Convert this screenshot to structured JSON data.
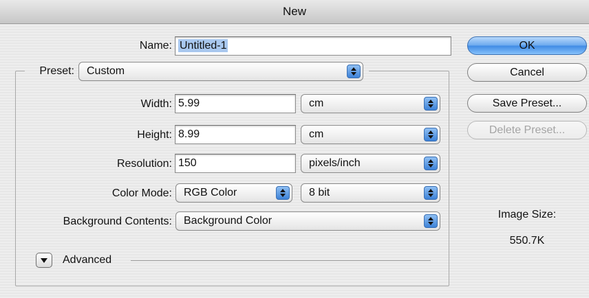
{
  "window": {
    "title": "New"
  },
  "name": {
    "label": "Name:",
    "value": "Untitled-1"
  },
  "preset": {
    "label": "Preset:",
    "value": "Custom"
  },
  "width": {
    "label": "Width:",
    "value": "5.99",
    "unit": "cm"
  },
  "height": {
    "label": "Height:",
    "value": "8.99",
    "unit": "cm"
  },
  "resolution": {
    "label": "Resolution:",
    "value": "150",
    "unit": "pixels/inch"
  },
  "color_mode": {
    "label": "Color Mode:",
    "value": "RGB Color",
    "depth": "8 bit"
  },
  "background": {
    "label": "Background Contents:",
    "value": "Background Color"
  },
  "advanced": {
    "label": "Advanced"
  },
  "buttons": {
    "ok": "OK",
    "cancel": "Cancel",
    "save_preset": "Save Preset...",
    "delete_preset": "Delete Preset..."
  },
  "image_size": {
    "label": "Image Size:",
    "value": "550.7K"
  },
  "colors": {
    "accent": "#3f8ae4",
    "selection": "#a9c8ef"
  }
}
